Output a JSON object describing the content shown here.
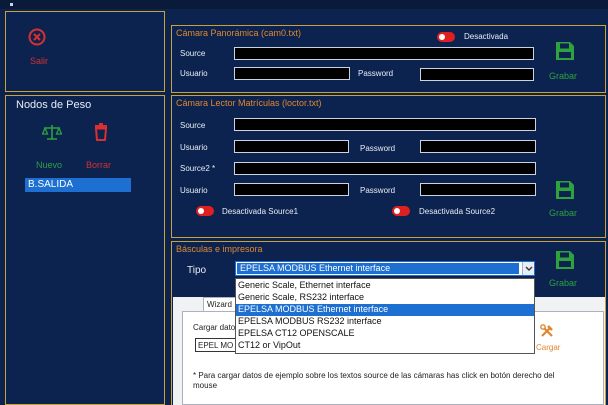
{
  "sidebar": {
    "exit_label": "Salir",
    "weight_nodes_title": "Nodos de Peso",
    "new_label": "Nuevo",
    "delete_label": "Borrar",
    "nodes": [
      "B.SALIDA"
    ]
  },
  "pano": {
    "title": "Cámara Panorámica (cam0.txt)",
    "toggle_label": "Desactivada",
    "source_label": "Source",
    "user_label": "Usuario",
    "password_label": "Password",
    "save_label": "Grabar"
  },
  "plate": {
    "title": "Cámara Lector Matrículas (loctor.txt)",
    "source_label": "Source",
    "user_label": "Usuario",
    "password_label": "Password",
    "source2_label": "Source2 *",
    "user2_label": "Usuario",
    "password2_label": "Password",
    "toggle1_label": "Desactivada Source1",
    "toggle2_label": "Desactivada Source2",
    "save_label": "Grabar"
  },
  "scales": {
    "title": "Básculas e impresora",
    "type_label": "Tipo",
    "selected": "EPELSA MODBUS Ethernet interface",
    "save_label": "Grabar",
    "options": [
      "Generic Scale, Ethernet interface",
      "Generic Scale, RS232 interface",
      "EPELSA MODBUS Ethernet interface",
      "EPELSA MODBUS RS232 interface",
      "EPELSA CT12 OPENSCALE",
      "CT12 or VipOut"
    ],
    "selected_index": 2,
    "tab_wizard": "Wizard",
    "load_data_label": "Cargar dato",
    "epel_value": "EPEL MO",
    "load_label": "Cargar",
    "note": "* Para cargar datos de ejemplo sobre los textos source de las cámaras has click en botón derecho del mouse"
  },
  "colors": {
    "accent": "#c9a23a",
    "orange": "#e0872e",
    "green": "#2ea23c",
    "red": "#d63030",
    "selection": "#1d6fd1"
  }
}
